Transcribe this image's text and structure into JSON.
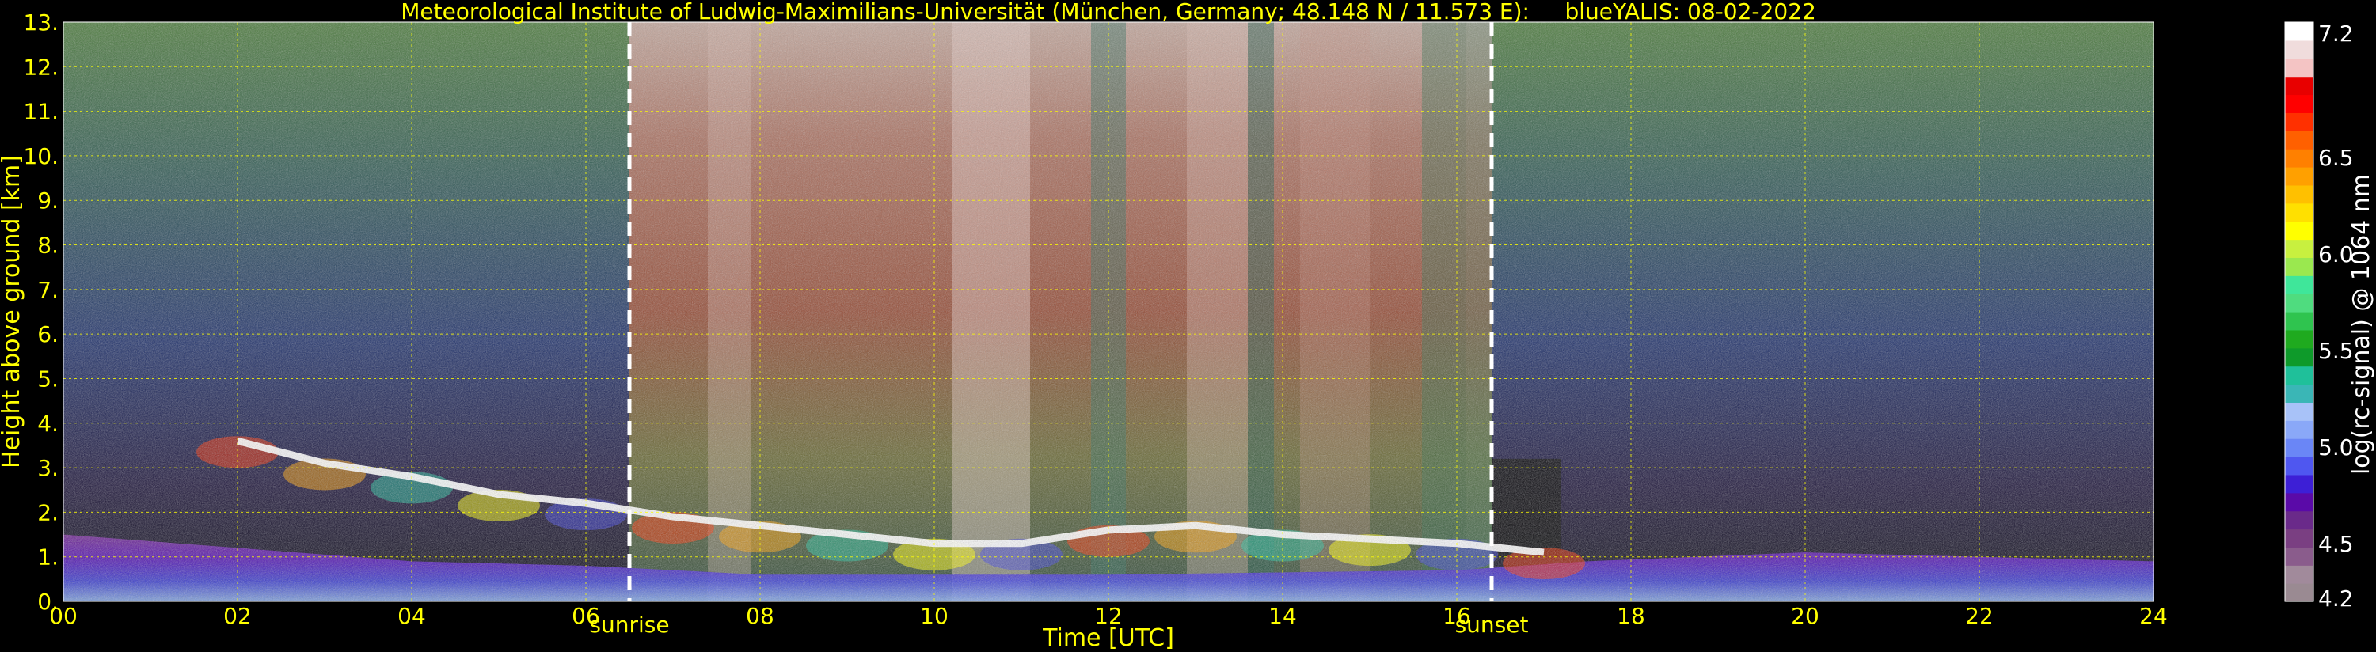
{
  "chart_data": {
    "type": "heatmap",
    "title": "Meteorological Institute of Ludwig-Maximilians-Universität (München, Germany; 48.148 N / 11.573 E):     blueYALIS: 08-02-2022",
    "xlabel": "Time [UTC]",
    "ylabel": "Height above ground [km]",
    "xlim": [
      0,
      24
    ],
    "ylim": [
      0,
      13
    ],
    "x_ticks": [
      "00",
      "02",
      "04",
      "06",
      "08",
      "10",
      "12",
      "14",
      "16",
      "18",
      "20",
      "22",
      "24"
    ],
    "y_ticks": [
      "0.",
      "1.",
      "2.",
      "3.",
      "4.",
      "5.",
      "6.",
      "7.",
      "8.",
      "9.",
      "10.",
      "11.",
      "12.",
      "13."
    ],
    "grid": true,
    "markers": [
      {
        "label": "sunrise",
        "x": 6.5
      },
      {
        "label": "sunset",
        "x": 16.4
      }
    ],
    "colorbar": {
      "label": "log(rc-signal) @ 1064 nm",
      "range": [
        4.2,
        7.2
      ],
      "ticks": [
        "4.2",
        "4.5",
        "5.0",
        "5.5",
        "6.0",
        "6.5",
        "7.2"
      ],
      "tick_values": [
        4.2,
        4.5,
        5.0,
        5.5,
        6.0,
        6.5,
        7.2
      ],
      "colors": [
        "#9a8a92",
        "#a18a9b",
        "#8a5c8c",
        "#7a3f82",
        "#6a2a8a",
        "#5a0aa8",
        "#3d1fd6",
        "#4f57f0",
        "#6a86f6",
        "#8aa8f8",
        "#a8c2f8",
        "#3ab6b6",
        "#1fc09a",
        "#0e9a2a",
        "#1faa1f",
        "#2fc44f",
        "#4fdc7f",
        "#3fe69a",
        "#9ae84f",
        "#c8f03f",
        "#ffff00",
        "#ffe000",
        "#ffc000",
        "#ffa000",
        "#ff8000",
        "#ff6000",
        "#ff3000",
        "#ff0000",
        "#e80000",
        "#f4c4c4",
        "#f0dcdc",
        "#ffffff"
      ]
    },
    "cloud_layer_heights_km": [
      {
        "t": 2.0,
        "h": 3.6
      },
      {
        "t": 3.0,
        "h": 3.1
      },
      {
        "t": 4.0,
        "h": 2.8
      },
      {
        "t": 5.0,
        "h": 2.4
      },
      {
        "t": 6.0,
        "h": 2.2
      },
      {
        "t": 7.0,
        "h": 1.9
      },
      {
        "t": 8.0,
        "h": 1.7
      },
      {
        "t": 9.0,
        "h": 1.5
      },
      {
        "t": 10.0,
        "h": 1.3
      },
      {
        "t": 11.0,
        "h": 1.3
      },
      {
        "t": 12.0,
        "h": 1.6
      },
      {
        "t": 13.0,
        "h": 1.7
      },
      {
        "t": 14.0,
        "h": 1.5
      },
      {
        "t": 15.0,
        "h": 1.4
      },
      {
        "t": 16.0,
        "h": 1.3
      },
      {
        "t": 17.0,
        "h": 1.1
      }
    ],
    "boundary_layer_top_km": [
      {
        "t": 0,
        "h": 1.5
      },
      {
        "t": 2,
        "h": 1.2
      },
      {
        "t": 4,
        "h": 0.9
      },
      {
        "t": 6,
        "h": 0.8
      },
      {
        "t": 8,
        "h": 0.6
      },
      {
        "t": 12,
        "h": 0.6
      },
      {
        "t": 16,
        "h": 0.7
      },
      {
        "t": 17.5,
        "h": 0.9
      },
      {
        "t": 20,
        "h": 1.1
      },
      {
        "t": 24,
        "h": 0.9
      }
    ]
  }
}
